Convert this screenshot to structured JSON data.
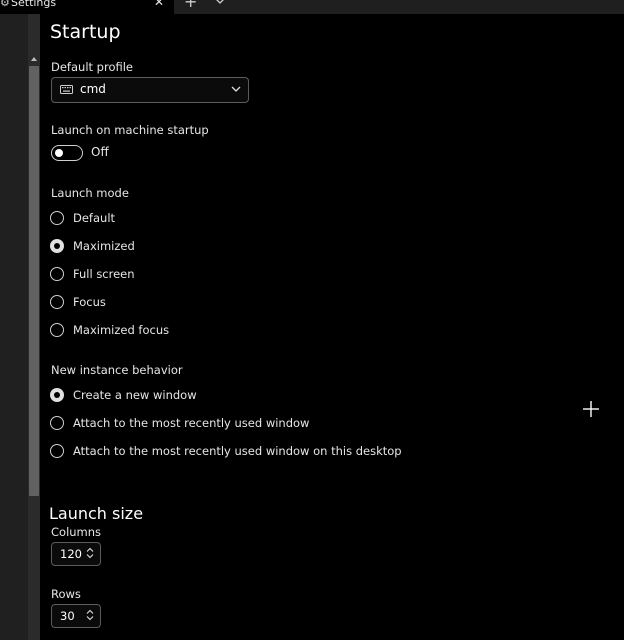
{
  "tab": {
    "title": "Settings",
    "close_glyph": "✕",
    "newtab_glyph": "+",
    "icon": "gear-icon"
  },
  "startup": {
    "page_title": "Startup",
    "default_profile": {
      "label": "Default profile",
      "value": "cmd",
      "icon": "keyboard-icon"
    },
    "launch_on_startup": {
      "label": "Launch on machine startup",
      "state_text": "Off",
      "enabled": false
    },
    "launch_mode": {
      "label": "Launch mode",
      "options": [
        "Default",
        "Maximized",
        "Full screen",
        "Focus",
        "Maximized focus"
      ],
      "selected": "Maximized"
    },
    "new_instance": {
      "label": "New instance behavior",
      "options": [
        "Create a new window",
        "Attach to the most recently used window",
        "Attach to the most recently used window on this desktop"
      ],
      "selected": "Create a new window"
    }
  },
  "launch_size": {
    "title": "Launch size",
    "columns_label": "Columns",
    "columns_value": "120",
    "rows_label": "Rows",
    "rows_value": "30"
  },
  "colors": {
    "background": "#000000",
    "nav_pane": "#202020",
    "scroll_thumb": "#616161"
  }
}
